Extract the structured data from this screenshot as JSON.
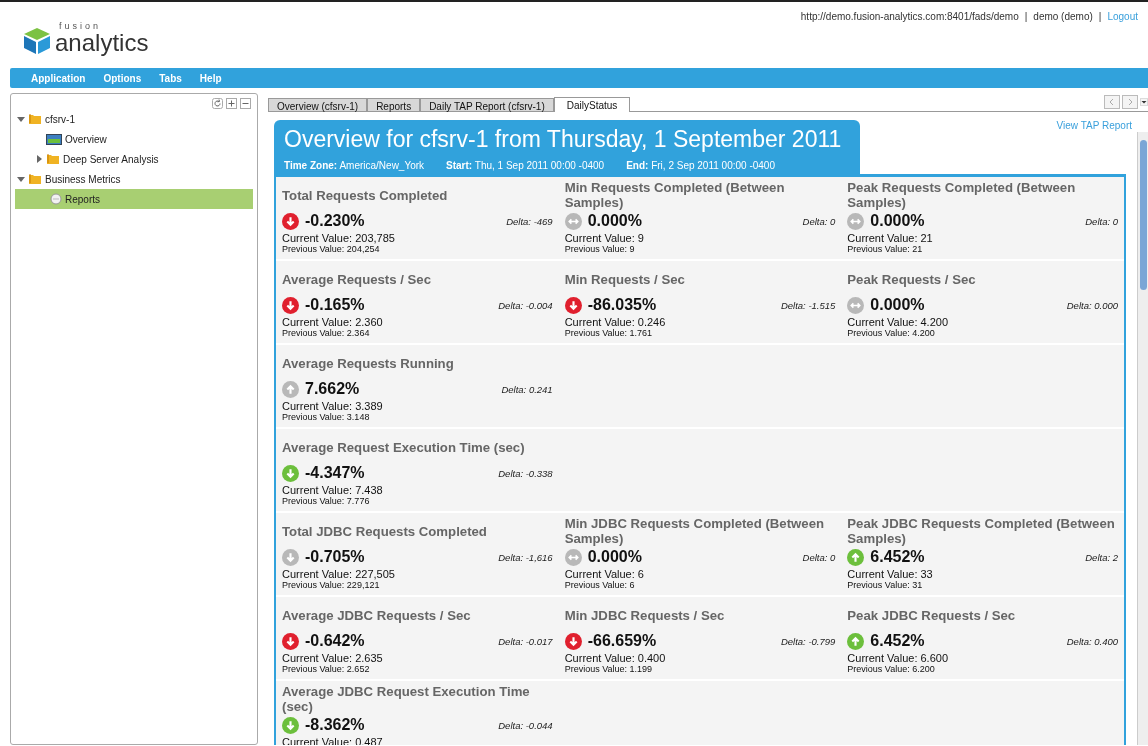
{
  "header": {
    "logo_small": "fusion",
    "logo_main": "analytics",
    "url": "http://demo.fusion-analytics.com:8401/fads/demo",
    "separator_1": "|",
    "user": "demo (demo)",
    "separator_2": "|",
    "logout": "Logout"
  },
  "menu": [
    "Application",
    "Options",
    "Tabs",
    "Help"
  ],
  "tree": [
    {
      "label": "cfsrv-1",
      "kind": "folder",
      "expanded": true,
      "selected": false,
      "children": [
        {
          "label": "Overview",
          "kind": "dashboard",
          "selected": false
        },
        {
          "label": "Deep Server Analysis",
          "kind": "folder",
          "expanded": false,
          "selected": false
        }
      ]
    },
    {
      "label": "Business Metrics",
      "kind": "folder",
      "expanded": true,
      "selected": false,
      "children": [
        {
          "label": "Reports",
          "kind": "report",
          "selected": true
        }
      ]
    }
  ],
  "tabs": [
    {
      "label": "Overview (cfsrv-1)",
      "selected": false
    },
    {
      "label": "Reports",
      "selected": false
    },
    {
      "label": "Daily TAP Report (cfsrv-1)",
      "selected": false
    },
    {
      "label": "DailyStatus",
      "selected": true
    }
  ],
  "report": {
    "title": "Overview for cfsrv-1 from Thursday, 1 September 2011",
    "meta": [
      {
        "label": "Time Zone:",
        "value": "America/New_York"
      },
      {
        "label": "Start:",
        "value": "Thu, 1 Sep 2011 00:00 -0400"
      },
      {
        "label": "End:",
        "value": "Fri, 2 Sep 2011 00:00 -0400"
      }
    ],
    "link": "View TAP Report",
    "rows": [
      [
        {
          "title": "Total Requests Completed",
          "kind": "down",
          "color": "#e0202e",
          "change": "-0.230%",
          "delta": "Delta: -469",
          "current": "Current Value: 203,785",
          "previous": "Previous Value: 204,254"
        },
        {
          "title": "Min Requests Completed (Between Samples)",
          "kind": "flat",
          "color": "#b8b8b8",
          "change": "0.000%",
          "delta": "Delta: 0",
          "current": "Current Value: 9",
          "previous": "Previous Value: 9"
        },
        {
          "title": "Peak Requests Completed (Between Samples)",
          "kind": "flat",
          "color": "#b8b8b8",
          "change": "0.000%",
          "delta": "Delta: 0",
          "current": "Current Value: 21",
          "previous": "Previous Value: 21"
        }
      ],
      [
        {
          "title": "Average Requests / Sec",
          "kind": "down",
          "color": "#e0202e",
          "change": "-0.165%",
          "delta": "Delta: -0.004",
          "current": "Current Value: 2.360",
          "previous": "Previous Value: 2.364"
        },
        {
          "title": "Min Requests / Sec",
          "kind": "down",
          "color": "#e0202e",
          "change": "-86.035%",
          "delta": "Delta: -1.515",
          "current": "Current Value: 0.246",
          "previous": "Previous Value: 1.761"
        },
        {
          "title": "Peak Requests / Sec",
          "kind": "flat",
          "color": "#b8b8b8",
          "change": "0.000%",
          "delta": "Delta: 0.000",
          "current": "Current Value: 4.200",
          "previous": "Previous Value: 4.200"
        }
      ],
      [
        {
          "title": "Average Requests Running",
          "kind": "up",
          "color": "#b8b8b8",
          "change": "7.662%",
          "delta": "Delta: 0.241",
          "current": "Current Value: 3.389",
          "previous": "Previous Value: 3.148"
        }
      ],
      [
        {
          "title": "Average Request Execution Time (sec)",
          "kind": "down",
          "color": "#6cbf3c",
          "change": "-4.347%",
          "delta": "Delta: -0.338",
          "current": "Current Value: 7.438",
          "previous": "Previous Value: 7.776"
        }
      ],
      [
        {
          "title": "Total JDBC Requests Completed",
          "kind": "down",
          "color": "#b8b8b8",
          "change": "-0.705%",
          "delta": "Delta: -1,616",
          "current": "Current Value: 227,505",
          "previous": "Previous Value: 229,121"
        },
        {
          "title": "Min JDBC Requests Completed (Between Samples)",
          "kind": "flat",
          "color": "#b8b8b8",
          "change": "0.000%",
          "delta": "Delta: 0",
          "current": "Current Value: 6",
          "previous": "Previous Value: 6"
        },
        {
          "title": "Peak JDBC Requests Completed (Between Samples)",
          "kind": "up",
          "color": "#6cbf3c",
          "change": "6.452%",
          "delta": "Delta: 2",
          "current": "Current Value: 33",
          "previous": "Previous Value: 31"
        }
      ],
      [
        {
          "title": "Average JDBC Requests / Sec",
          "kind": "down",
          "color": "#e0202e",
          "change": "-0.642%",
          "delta": "Delta: -0.017",
          "current": "Current Value: 2.635",
          "previous": "Previous Value: 2.652"
        },
        {
          "title": "Min JDBC Requests / Sec",
          "kind": "down",
          "color": "#e0202e",
          "change": "-66.659%",
          "delta": "Delta: -0.799",
          "current": "Current Value: 0.400",
          "previous": "Previous Value: 1.199"
        },
        {
          "title": "Peak JDBC Requests / Sec",
          "kind": "up",
          "color": "#6cbf3c",
          "change": "6.452%",
          "delta": "Delta: 0.400",
          "current": "Current Value: 6.600",
          "previous": "Previous Value: 6.200"
        }
      ],
      [
        {
          "title": "Average JDBC Request Execution Time (sec)",
          "kind": "down",
          "color": "#6cbf3c",
          "change": "-8.362%",
          "delta": "Delta: -0.044",
          "current": "Current Value: 0.487"
        }
      ]
    ]
  }
}
